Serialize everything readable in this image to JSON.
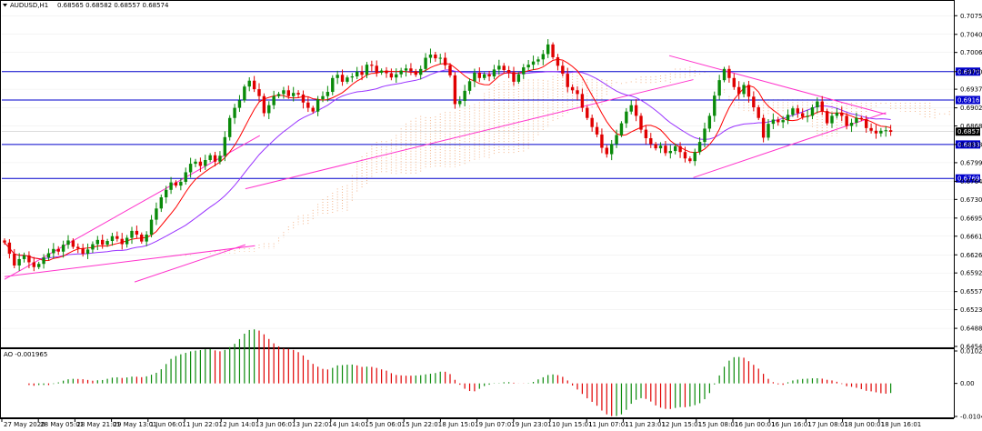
{
  "symbol_header": {
    "symbol": "AUDUSD,H1",
    "ohlc": "0.68565 0.68582 0.68557 0.68574",
    "icon": "triangle-down-icon"
  },
  "ao_header": {
    "label": "AO -0.001965"
  },
  "colors": {
    "bull": "#0a8a0a",
    "bear": "#e00000",
    "level_line": "#0000cc",
    "level_tag_bg": "#0000cc",
    "current_tag_bg": "#000000",
    "trend_line": "#ff33cc",
    "ma_fast": "#ff0000",
    "ma_slow": "#9933ff",
    "cloud": "#f4a460",
    "cloud_dots": "#f2b48a",
    "ao_up": "#0a8a0a",
    "ao_down": "#e00000",
    "grid": "#e9e9e9",
    "frame": "#000000"
  },
  "chart_data": [
    {
      "type": "candlestick",
      "symbol": "AUDUSD",
      "timeframe": "H1",
      "price_ticks": [
        "0.70750",
        "0.70400",
        "0.70060",
        "0.69700",
        "0.69370",
        "0.69020",
        "0.68680",
        "0.68332",
        "0.67990",
        "0.67640",
        "0.67300",
        "0.66950",
        "0.66610",
        "0.66260",
        "0.65920",
        "0.65570",
        "0.65230",
        "0.64880",
        "0.64540"
      ],
      "ylim": [
        0.6454,
        0.7084
      ],
      "time_labels": [
        "27 May 2020",
        "28 May 05:01",
        "28 May 21:01",
        "29 May 13:01",
        "1 Jun 06:01",
        "1 Jun 22:01",
        "2 Jun 14:01",
        "3 Jun 06:01",
        "3 Jun 22:01",
        "4 Jun 14:01",
        "5 Jun 06:01",
        "5 Jun 22:01",
        "8 Jun 15:01",
        "9 Jun 07:01",
        "9 Jun 23:01",
        "10 Jun 15:01",
        "11 Jun 07:01",
        "11 Jun 23:01",
        "12 Jun 15:01",
        "15 Jun 08:01",
        "16 Jun 00:01",
        "16 Jun 16:01",
        "17 Jun 08:01",
        "18 Jun 00:01",
        "18 Jun 16:01"
      ],
      "levels": [
        {
          "price": 0.697,
          "label": "0.69700"
        },
        {
          "price": 0.69167,
          "label": "0.69167"
        },
        {
          "price": 0.68332,
          "label": "0.68332"
        },
        {
          "price": 0.67695,
          "label": "0.67695"
        }
      ],
      "current_price": {
        "price": 0.68574,
        "label": "0.68574"
      },
      "closes": [
        0.6649,
        0.6628,
        0.6606,
        0.6618,
        0.6625,
        0.6612,
        0.6603,
        0.6609,
        0.6621,
        0.6629,
        0.6637,
        0.6632,
        0.6645,
        0.6653,
        0.6641,
        0.6638,
        0.6628,
        0.6636,
        0.6646,
        0.6654,
        0.6645,
        0.6652,
        0.6661,
        0.6656,
        0.6646,
        0.6658,
        0.6671,
        0.6664,
        0.6651,
        0.6664,
        0.6692,
        0.6713,
        0.6734,
        0.6748,
        0.6762,
        0.6756,
        0.6763,
        0.6781,
        0.6797,
        0.6801,
        0.6793,
        0.6804,
        0.6813,
        0.6801,
        0.6812,
        0.6847,
        0.6883,
        0.6902,
        0.6916,
        0.6942,
        0.6953,
        0.6937,
        0.6924,
        0.6892,
        0.6907,
        0.6924,
        0.6928,
        0.6935,
        0.6924,
        0.693,
        0.6927,
        0.6912,
        0.6902,
        0.6895,
        0.6918,
        0.6924,
        0.6932,
        0.6958,
        0.6964,
        0.6951,
        0.6959,
        0.6961,
        0.697,
        0.6964,
        0.6983,
        0.6981,
        0.6968,
        0.6972,
        0.6967,
        0.6959,
        0.6965,
        0.6972,
        0.6976,
        0.6971,
        0.6964,
        0.6975,
        0.6996,
        0.7002,
        0.6995,
        0.6996,
        0.6982,
        0.6963,
        0.6909,
        0.6915,
        0.6934,
        0.6952,
        0.6968,
        0.6958,
        0.6965,
        0.6961,
        0.6974,
        0.6981,
        0.6973,
        0.6969,
        0.6951,
        0.6965,
        0.6978,
        0.6983,
        0.6989,
        0.6993,
        0.7003,
        0.7021,
        0.6997,
        0.6981,
        0.6966,
        0.6941,
        0.6935,
        0.6928,
        0.6902,
        0.6883,
        0.6866,
        0.6852,
        0.6827,
        0.6815,
        0.6834,
        0.6851,
        0.6873,
        0.6895,
        0.6907,
        0.6887,
        0.6861,
        0.6845,
        0.6834,
        0.6826,
        0.6831,
        0.6817,
        0.6821,
        0.683,
        0.6819,
        0.6807,
        0.6802,
        0.6819,
        0.6838,
        0.6863,
        0.6887,
        0.6925,
        0.6954,
        0.6975,
        0.6958,
        0.6941,
        0.6928,
        0.6945,
        0.6923,
        0.6903,
        0.6883,
        0.6846,
        0.6872,
        0.688,
        0.6875,
        0.6879,
        0.6889,
        0.6901,
        0.6892,
        0.6885,
        0.6887,
        0.6903,
        0.6914,
        0.6896,
        0.6873,
        0.6887,
        0.6893,
        0.6887,
        0.6868,
        0.6874,
        0.6883,
        0.6881,
        0.6864,
        0.6859,
        0.6854,
        0.6859,
        0.686,
        0.6857
      ],
      "ao": {
        "label": "AO -0.001965",
        "ylim": [
          -0.010443,
          0.010241
        ],
        "ticks": [
          "0.010241",
          "0.00",
          "-0.010443"
        ]
      }
    }
  ]
}
